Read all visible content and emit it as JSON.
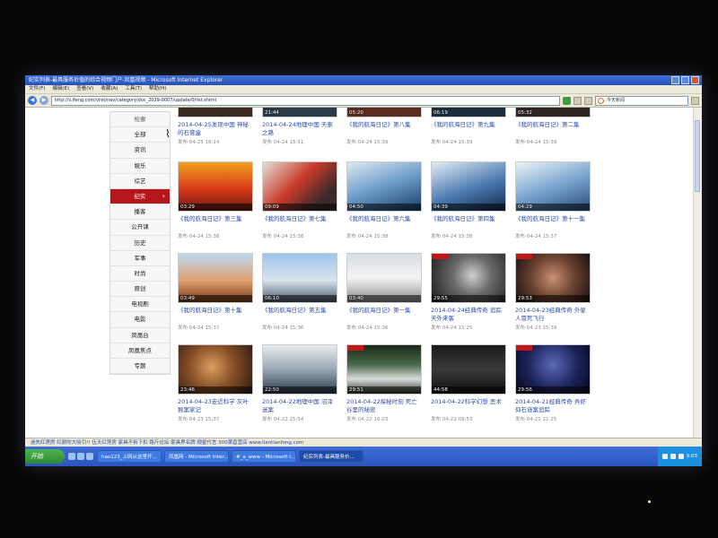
{
  "window": {
    "title": "纪实列表-最具服务价值的综合视频门户-凤凰视频 - Microsoft Internet Explorer",
    "menu": [
      "文件(F)",
      "编辑(E)",
      "查看(V)",
      "收藏(A)",
      "工具(T)",
      "帮助(H)"
    ],
    "address": "http://v.ifeng.com/vlist/nav/category/doc_2029-0007/update/0/list.shtml",
    "search_value": "今天新闻"
  },
  "sidebar": {
    "items": [
      {
        "label": "检索"
      },
      {
        "label": "全部"
      },
      {
        "label": "资讯"
      },
      {
        "label": "娱乐"
      },
      {
        "label": "综艺"
      },
      {
        "label": "纪实",
        "active": true
      },
      {
        "label": "播客"
      },
      {
        "label": "公开课"
      },
      {
        "label": "历史"
      },
      {
        "label": "军事"
      },
      {
        "label": "时尚"
      },
      {
        "label": "原创"
      },
      {
        "label": "电视剧"
      },
      {
        "label": "电影"
      },
      {
        "label": "凤凰台"
      },
      {
        "label": "凤凰焦点"
      },
      {
        "label": "专题"
      }
    ]
  },
  "videos": {
    "row0": [
      {
        "duration": "",
        "title": "2014-04-25发现中国 神秘的石膏盒",
        "date": "发布 04-25 16:14"
      },
      {
        "duration": "21:44",
        "title": "2014-04-24地理中国 天索之路",
        "date": "发布 04-24 15:51"
      },
      {
        "duration": "05:20",
        "title": "《我的航海日记》第八集",
        "date": "发布 04-24 15:39"
      },
      {
        "duration": "06:19",
        "title": "《我的航海日记》第九集",
        "date": "发布 04-24 15:39"
      },
      {
        "duration": "05:32",
        "title": "《我的航海日记》第二集",
        "date": "发布 04-24 15:39"
      }
    ],
    "row1": [
      {
        "duration": "03:29",
        "title": "《我的航海日记》第三集",
        "date": "发布 04-24 15:38"
      },
      {
        "duration": "09:09",
        "title": "《我的航海日记》第七集",
        "date": "发布 04-24 15:38"
      },
      {
        "duration": "04:50",
        "title": "《我的航海日记》第六集",
        "date": "发布 04-24 15:38"
      },
      {
        "duration": "04:39",
        "title": "《我的航海日记》第四集",
        "date": "发布 04-24 15:38"
      },
      {
        "duration": "04:29",
        "title": "《我的航海日记》第十一集",
        "date": "发布 04-24 15:37"
      }
    ],
    "row2": [
      {
        "duration": "03:49",
        "title": "《我的航海日记》第十集",
        "date": "发布 04-24 15:37"
      },
      {
        "duration": "06:10",
        "title": "《我的航海日记》第五集",
        "date": "发布 04-24 15:36"
      },
      {
        "duration": "03:40",
        "title": "《我的航海日记》第一集",
        "date": "发布 04-24 15:36"
      },
      {
        "duration": "29:55",
        "title": "2014-04-24经典传奇 追踪天外来客",
        "date": "发布 04-24 15:25"
      },
      {
        "duration": "29:53",
        "title": "2014-04-23经典传奇 外星人冒死飞行",
        "date": "发布 04-23 15:39"
      }
    ],
    "row3": [
      {
        "duration": "23:46",
        "title": "2014-04-23走近科学 灰叶猴案家记",
        "date": "发布 04-23 15:37"
      },
      {
        "duration": "22:50",
        "title": "2014-04-22地理中国 沼泽迷案",
        "date": "发布 04-22 15:54"
      },
      {
        "duration": "29:51",
        "title": "2014-04-22探秘时刻 死亡谷里的秘密",
        "date": "发布 04-22 16:03"
      },
      {
        "duration": "44:58",
        "title": "2014-04-22科学幻想 恶术",
        "date": "发布 04-22 09:53"
      },
      {
        "duration": "29:56",
        "title": "2014-04-21经典传奇 弄虾仰石谜案追踪",
        "date": "发布 04-21 21:25"
      }
    ]
  },
  "status": {
    "text": "迷失红莲房 红颜吹大吸引!! 伍天红莲房 家具不拆下扣 路斤论坛 家具界名牌 顺星代言 300萧直营店 www.liantianfong.com"
  },
  "taskbar": {
    "start_label": "开始",
    "tasks": [
      "hao123_上网从这里开...",
      "凤凰网 - Microsoft Inter...",
      "#_a_www - Microsoft I...",
      "纪实列表-最具服务价..."
    ],
    "clock": "9:03"
  },
  "colors": {
    "accent_red": "#b4161b",
    "link_blue": "#2a4da8",
    "taskbar_blue": "#2a55bf"
  },
  "icons": {
    "back": "back-arrow-icon",
    "forward": "forward-arrow-icon",
    "go": "go-arrow-icon",
    "search": "search-icon",
    "nav_arrow": "chevron-right-icon"
  }
}
